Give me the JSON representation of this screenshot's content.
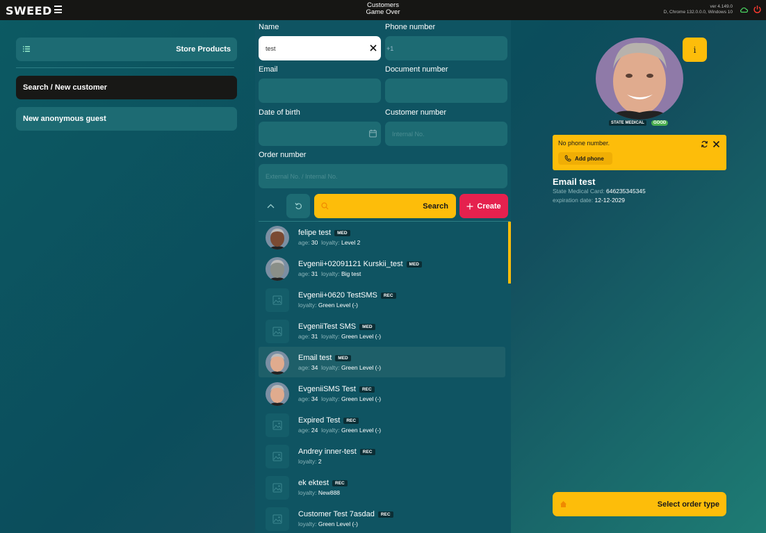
{
  "app": {
    "logo": "SWEED",
    "title_line1": "Customers",
    "title_line2": "Game Over",
    "version_line1": "ver 4.149.0",
    "version_line2": "D, Chrome 132.0.0.0, Windows 10"
  },
  "left": {
    "store_products": "Store Products",
    "search_new": "Search / New customer",
    "new_anonymous": "New anonymous guest"
  },
  "form": {
    "name_label": "Name",
    "name_value": "test",
    "phone_label": "Phone number",
    "phone_prefix": "+1",
    "email_label": "Email",
    "document_label": "Document number",
    "dob_label": "Date of birth",
    "customer_number_label": "Customer number",
    "customer_number_placeholder": "Internal No.",
    "order_number_label": "Order number",
    "order_number_placeholder": "External No. / Internal No."
  },
  "actions": {
    "search": "Search",
    "create": "Create"
  },
  "customers": [
    {
      "name": "felipe test",
      "badge": "MED",
      "age": "30",
      "loyalty": "Level 2"
    },
    {
      "name": "Evgenii+02091121 Kurskii_test",
      "badge": "MED",
      "age": "31",
      "loyalty": "Big test"
    },
    {
      "name": "Evgenii+0620 TestSMS",
      "badge": "REC",
      "age": "",
      "loyalty": "Green Level (-)"
    },
    {
      "name": "EvgeniiTest SMS",
      "badge": "MED",
      "age": "31",
      "loyalty": "Green Level (-)"
    },
    {
      "name": "Email test",
      "badge": "MED",
      "age": "34",
      "loyalty": "Green Level (-)"
    },
    {
      "name": "EvgeniiSMS Test",
      "badge": "REC",
      "age": "34",
      "loyalty": "Green Level (-)"
    },
    {
      "name": "Expired Test",
      "badge": "REC",
      "age": "24",
      "loyalty": "Green Level (-)"
    },
    {
      "name": "Andrey inner-test",
      "badge": "REC",
      "age": "",
      "loyalty": "2"
    },
    {
      "name": "ek ektest",
      "badge": "REC",
      "age": "",
      "loyalty": "New888"
    },
    {
      "name": "Customer Test 7asdad",
      "badge": "REC",
      "age": "",
      "loyalty": "Green Level (-)"
    }
  ],
  "labels": {
    "age": "age:",
    "loyalty": "loyalty:"
  },
  "profile": {
    "med_label": "STATE MEDICAL",
    "status_label": "GOOD",
    "info": "i",
    "alert_text": "No phone number.",
    "add_phone": "Add phone",
    "name": "Email test",
    "card_label": "State Medical Card:",
    "card_value": "646235345345",
    "exp_label": "expiration date:",
    "exp_value": "12-12-2029",
    "order_type": "Select order type"
  },
  "colors": {
    "accent_yellow": "#fdbd0a",
    "create_red": "#e5214e",
    "panel_teal": "#1d6b73"
  }
}
